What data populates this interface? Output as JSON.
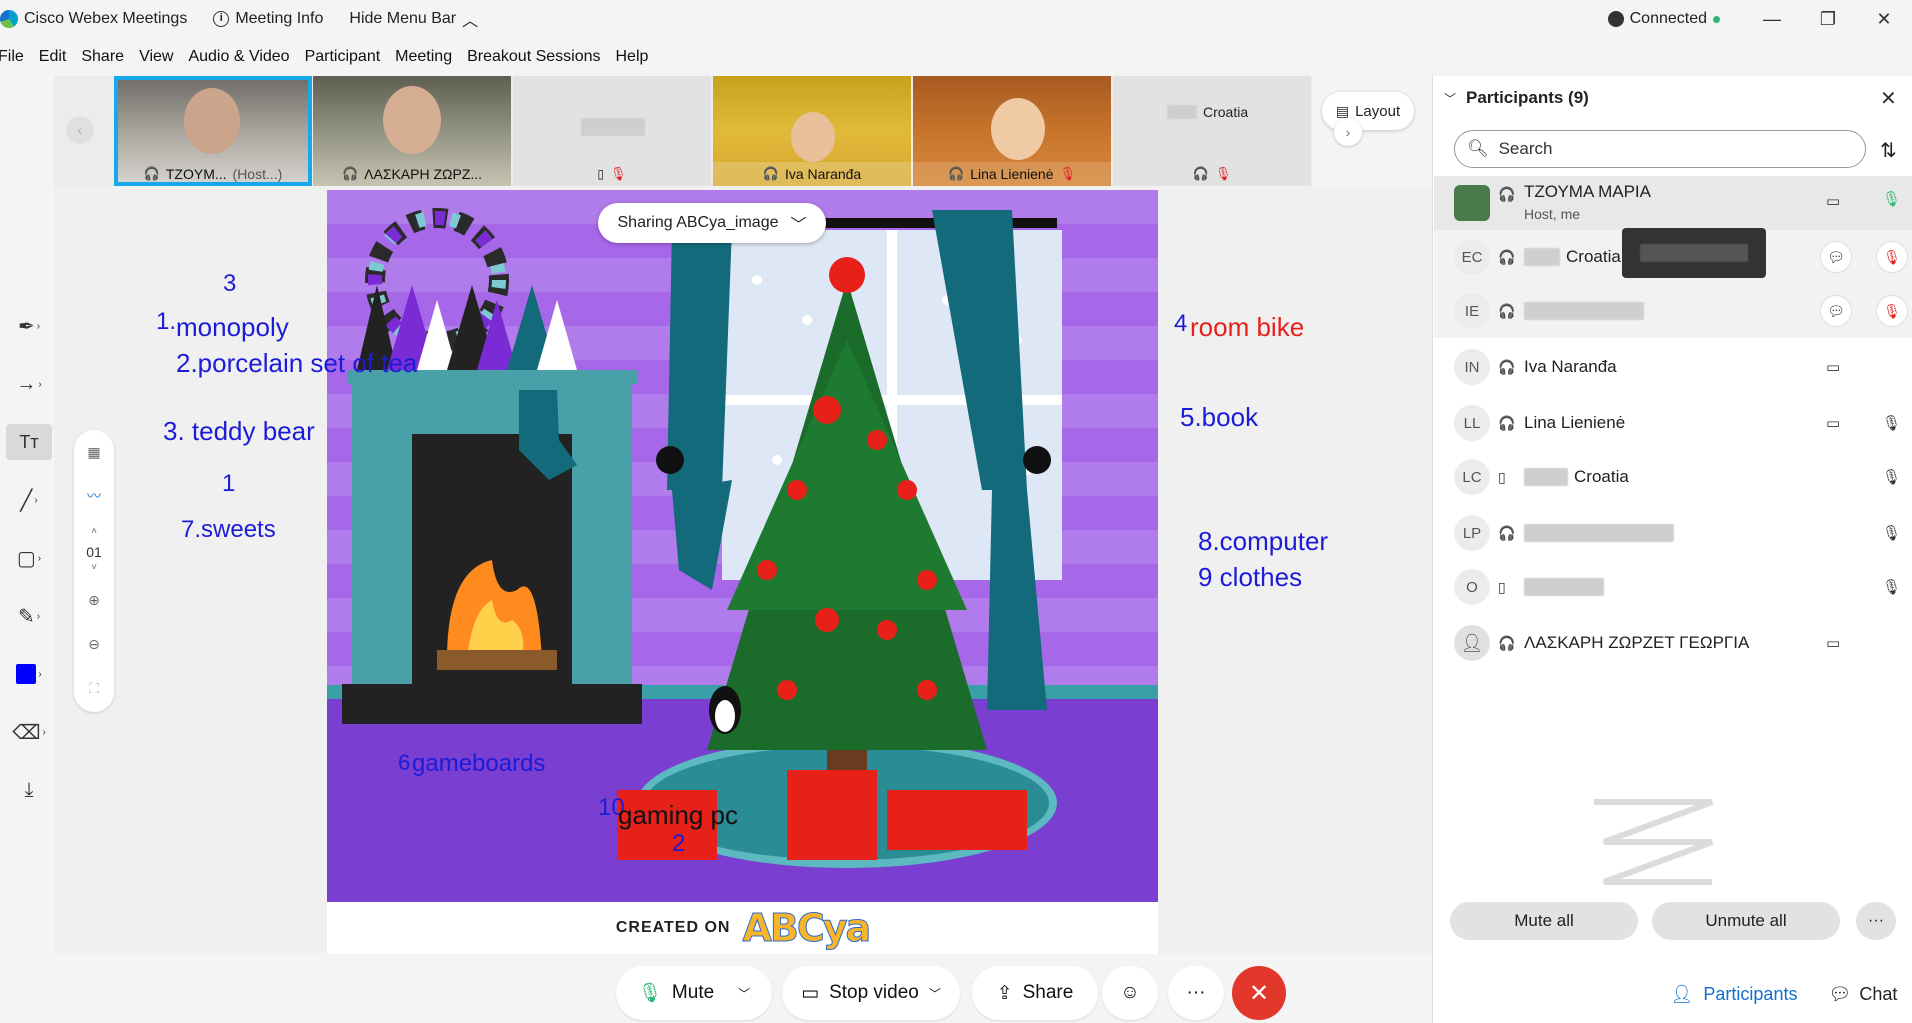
{
  "window": {
    "app_title": "Cisco Webex Meetings",
    "meeting_info": "Meeting Info",
    "hide_menu_bar": "Hide Menu Bar",
    "status": "Connected",
    "status_color": "#2bb673"
  },
  "menu": [
    "File",
    "Edit",
    "Share",
    "View",
    "Audio & Video",
    "Participant",
    "Meeting",
    "Breakout Sessions",
    "Help"
  ],
  "filmstrip": {
    "tiles": [
      {
        "name": "TZOYM...",
        "suffix": "(Host...)"
      },
      {
        "name": "ΛΑΣΚΑΡΗ ΖΩΡΖ..."
      },
      {
        "name": ""
      },
      {
        "name": "Iva Naranđa"
      },
      {
        "name": "Lina Lienienė"
      },
      {
        "name": "Croatia"
      }
    ],
    "layout_label": "Layout"
  },
  "zoom_panel": {
    "page": "01"
  },
  "share": {
    "pill_label": "Sharing ABCya_image",
    "footer_created": "CREATED ON",
    "footer_logo": "ABCya"
  },
  "annotations": [
    {
      "text": "3",
      "color": "blue"
    },
    {
      "text": "1.",
      "color": "blue"
    },
    {
      "text": "monopoly",
      "color": "blue"
    },
    {
      "text": "2.porcelain set of tea",
      "color": "blue"
    },
    {
      "text": "3. teddy bear",
      "color": "blue"
    },
    {
      "text": "1",
      "color": "blue"
    },
    {
      "text": "7.sweets",
      "color": "blue"
    },
    {
      "text": "4",
      "color": "blue"
    },
    {
      "text": "room bike",
      "color": "red"
    },
    {
      "text": "5.book",
      "color": "blue"
    },
    {
      "text": "8.computer",
      "color": "blue"
    },
    {
      "text": "9 clothes",
      "color": "blue"
    },
    {
      "text": "6",
      "color": "blue"
    },
    {
      "text": "gameboards",
      "color": "blue"
    },
    {
      "text": "10",
      "color": "blue"
    },
    {
      "text": "gaming pc",
      "color": "black"
    },
    {
      "text": "2",
      "color": "blue"
    }
  ],
  "participants": {
    "title": "Participants (9)",
    "search_placeholder": "Search",
    "rows": [
      {
        "initials": "",
        "name": "ΤΖΟΥΜΑ ΜΑΡΙΑ",
        "sub": "Host, me"
      },
      {
        "initials": "EC",
        "name": "Croatia"
      },
      {
        "initials": "IE",
        "name": ""
      },
      {
        "initials": "IN",
        "name": "Iva Naranđa"
      },
      {
        "initials": "LL",
        "name": "Lina Lienienė"
      },
      {
        "initials": "LC",
        "name": "Croatia"
      },
      {
        "initials": "LP",
        "name": ""
      },
      {
        "initials": "O",
        "name": ""
      },
      {
        "initials": "",
        "name": "ΛΑΣΚΑΡΗ ΖΩΡΖΕΤ ΓΕΩΡΓΙΑ"
      }
    ],
    "mute_all": "Mute all",
    "unmute_all": "Unmute all"
  },
  "controls": {
    "mute": "Mute",
    "stop_video": "Stop video",
    "share": "Share",
    "participants": "Participants",
    "chat": "Chat"
  }
}
